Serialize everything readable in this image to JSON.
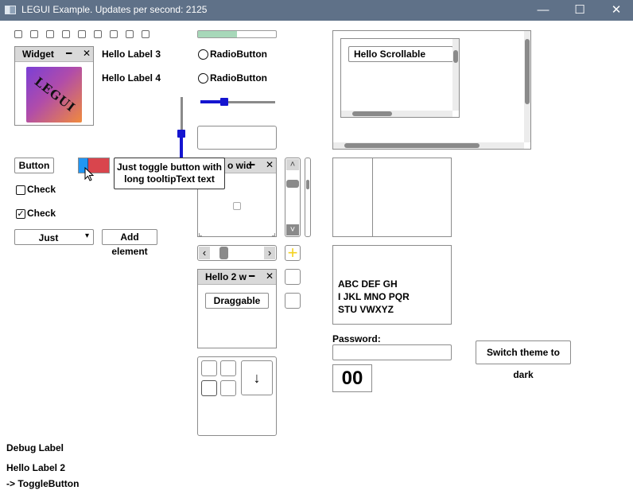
{
  "window": {
    "title": "LEGUI Example. Updates per second: 2125",
    "minimize_glyph": "—",
    "maximize_glyph": "☐",
    "close_glyph": "✕"
  },
  "widget": {
    "title": "Widget",
    "minimize_glyph": "━",
    "close_glyph": "✕",
    "logo_text": "LEGUI"
  },
  "labels": {
    "hello3": "Hello Label 3",
    "hello4": "Hello Label 4",
    "debug": "Debug Label",
    "hello2": "Hello Label 2",
    "toggle_event": "-> ToggleButton"
  },
  "radio": {
    "r1": "RadioButton",
    "r2": "RadioButton"
  },
  "progress": {
    "value_percent": 50
  },
  "slider_h": {
    "value_percent": 32
  },
  "slider_v": {
    "value_percent": 40
  },
  "buttons": {
    "button": "Button",
    "add_element": "Add element",
    "draggable": "Draggable",
    "switch_theme": "Switch theme to dark"
  },
  "checkboxes": {
    "check1": "Check",
    "check2": "Check",
    "check2_mark": "✓"
  },
  "select": {
    "value": "Just",
    "arrow": "▾"
  },
  "tooltip": {
    "line1": "Just toggle button with",
    "line2": "long tooltipText text"
  },
  "window2": {
    "title": "o wid",
    "minimize_glyph": "━",
    "close_glyph": "✕"
  },
  "window3": {
    "title": "Hello 2 w",
    "minimize_glyph": "━",
    "close_glyph": "✕"
  },
  "scroll_panel": {
    "label": "Hello Scrollable"
  },
  "text_area": {
    "lines": [
      "ABC DEF GH",
      "I JKL MNO PQR",
      "STU VWXYZ"
    ]
  },
  "password": {
    "label": "Password:",
    "value": ""
  },
  "counter": {
    "value": "00"
  },
  "icons": {
    "plus": "+",
    "down_arrow": "↓",
    "up_arrow": "˄",
    "down_small": "˅",
    "left_arrow": "‹",
    "right_arrow": "›"
  },
  "colors": {
    "titlebar": "#5f7188",
    "accent_blue": "#1515d0",
    "progress": "#a7d8b9",
    "toggle_red": "#d9454d",
    "toggle_blue": "#2196f3",
    "plus_yellow": "#f4d21f"
  }
}
